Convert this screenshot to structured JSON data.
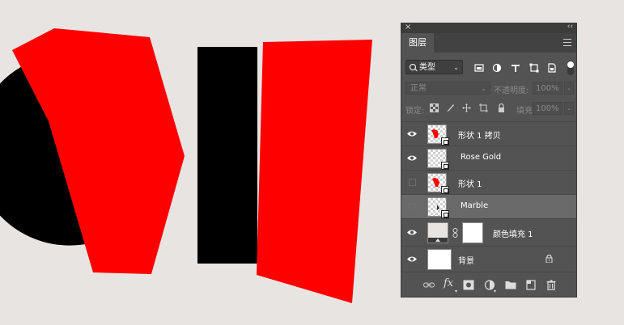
{
  "colors": {
    "canvas_bg": "#e8e4e1",
    "accent_red": "#ff0000",
    "shape_black": "#000000",
    "panel_bg": "#535353",
    "selected_row": "#696969"
  },
  "panel": {
    "tab_label": "图层",
    "close_icon": "close-icon",
    "collapse_icon": "double-chevron-icon",
    "menu_icon": "panel-menu-icon",
    "filter": {
      "kind_label": "类型",
      "icons": [
        "pixel-filter-icon",
        "adjustment-filter-icon",
        "type-filter-icon",
        "shape-filter-icon",
        "smart-object-filter-icon"
      ]
    },
    "blend": {
      "mode": "正常",
      "opacity_label": "不透明度:",
      "opacity_value": "100%"
    },
    "lock": {
      "label": "锁定:",
      "icons": [
        "lock-transparent-icon",
        "lock-image-icon",
        "lock-position-icon",
        "lock-artboard-icon",
        "lock-all-icon"
      ],
      "fill_label": "填充:",
      "fill_value": "100%"
    },
    "layers": [
      {
        "name": "形状 1 拷贝",
        "visible": true,
        "selected": false,
        "kind": "shape"
      },
      {
        "name": "Rose Gold",
        "visible": true,
        "selected": false,
        "kind": "shape"
      },
      {
        "name": "形状 1",
        "visible": false,
        "selected": false,
        "kind": "shape"
      },
      {
        "name": "Marble",
        "visible": false,
        "selected": true,
        "kind": "shape"
      },
      {
        "name": "颜色填充 1",
        "visible": true,
        "selected": false,
        "kind": "fill"
      },
      {
        "name": "背景",
        "visible": true,
        "selected": false,
        "kind": "background",
        "locked": true
      }
    ],
    "bottom_icons": [
      "link-layers-icon",
      "fx-icon",
      "add-mask-icon",
      "adjustment-layer-icon",
      "group-folder-icon",
      "new-layer-icon",
      "trash-icon"
    ]
  }
}
